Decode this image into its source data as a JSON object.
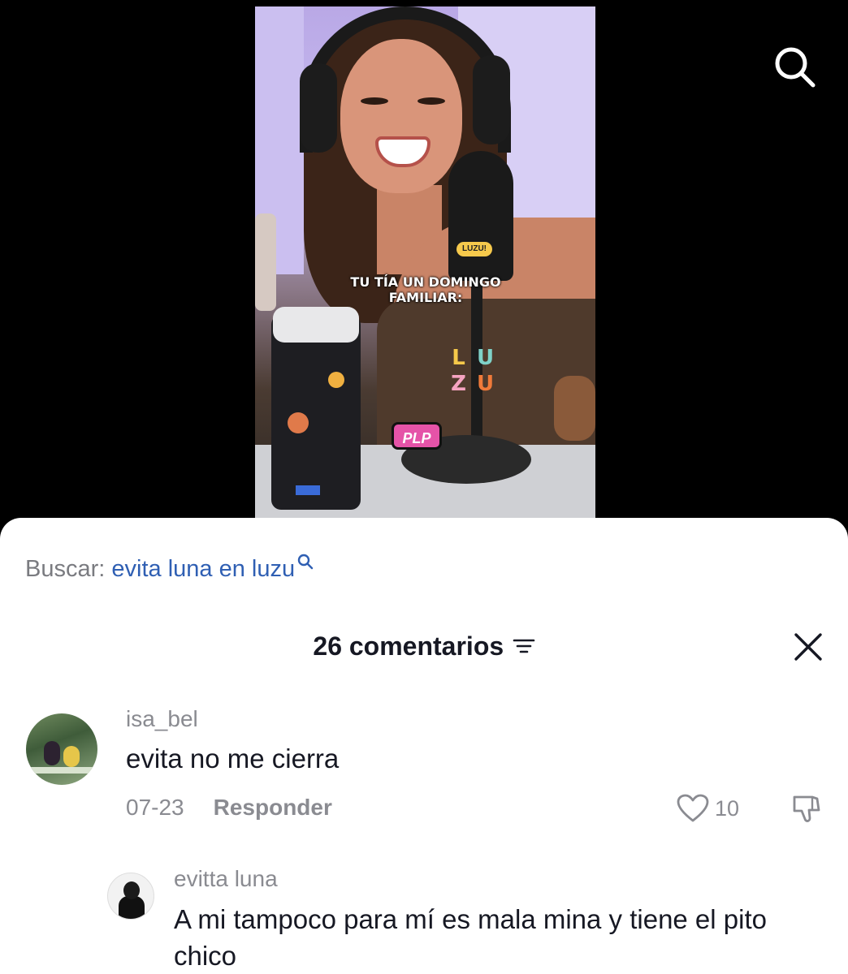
{
  "video": {
    "overlay_line1": "TU TÍA UN DOMINGO",
    "overlay_line2": "FAMILIAR:",
    "mic_badge": "LUZU!",
    "logo_letters": [
      "L",
      "U",
      "Z",
      "U"
    ],
    "logo_colors": [
      "#f5c84a",
      "#7fd2c8",
      "#f5a3c0",
      "#f07a3a"
    ],
    "badge": "PLP",
    "top_icon": "search-icon"
  },
  "search_suggest": {
    "prefix": "Buscar: ",
    "query": "evita luna en luzu",
    "icon": "search-icon"
  },
  "comments": {
    "title": "26 comentarios",
    "filter_icon": "filter-icon",
    "close_icon": "close-icon",
    "items": [
      {
        "username": "isa_bel",
        "text": "evita no me cierra",
        "date": "07-23",
        "reply_label": "Responder",
        "likes": "10"
      },
      {
        "username": "evitta luna",
        "text": "A mi tampoco para mí es mala mina y tiene el pito chico"
      }
    ]
  },
  "colors": {
    "link_blue": "#2f5fb3",
    "muted_gray": "#8a8b91",
    "text_dark": "#161823"
  }
}
